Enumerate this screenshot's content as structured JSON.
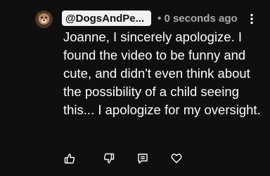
{
  "comment": {
    "author": "@DogsAndPe...",
    "separator": "•",
    "timestamp": "0 seconds ago",
    "text": "Joanne, I sincerely apologize. I found the video to be funny and cute, and didn't even think about the possibility of a child seeing this... I apologize for my oversight."
  },
  "actions": {
    "icons": [
      "thumbs-up-icon",
      "thumbs-down-icon",
      "reply-icon",
      "heart-icon"
    ]
  },
  "colors": {
    "background": "#0f0f0f",
    "text": "#ffffff",
    "secondary_text": "#aaaaaa",
    "chip_background": "#f1f1f1"
  }
}
